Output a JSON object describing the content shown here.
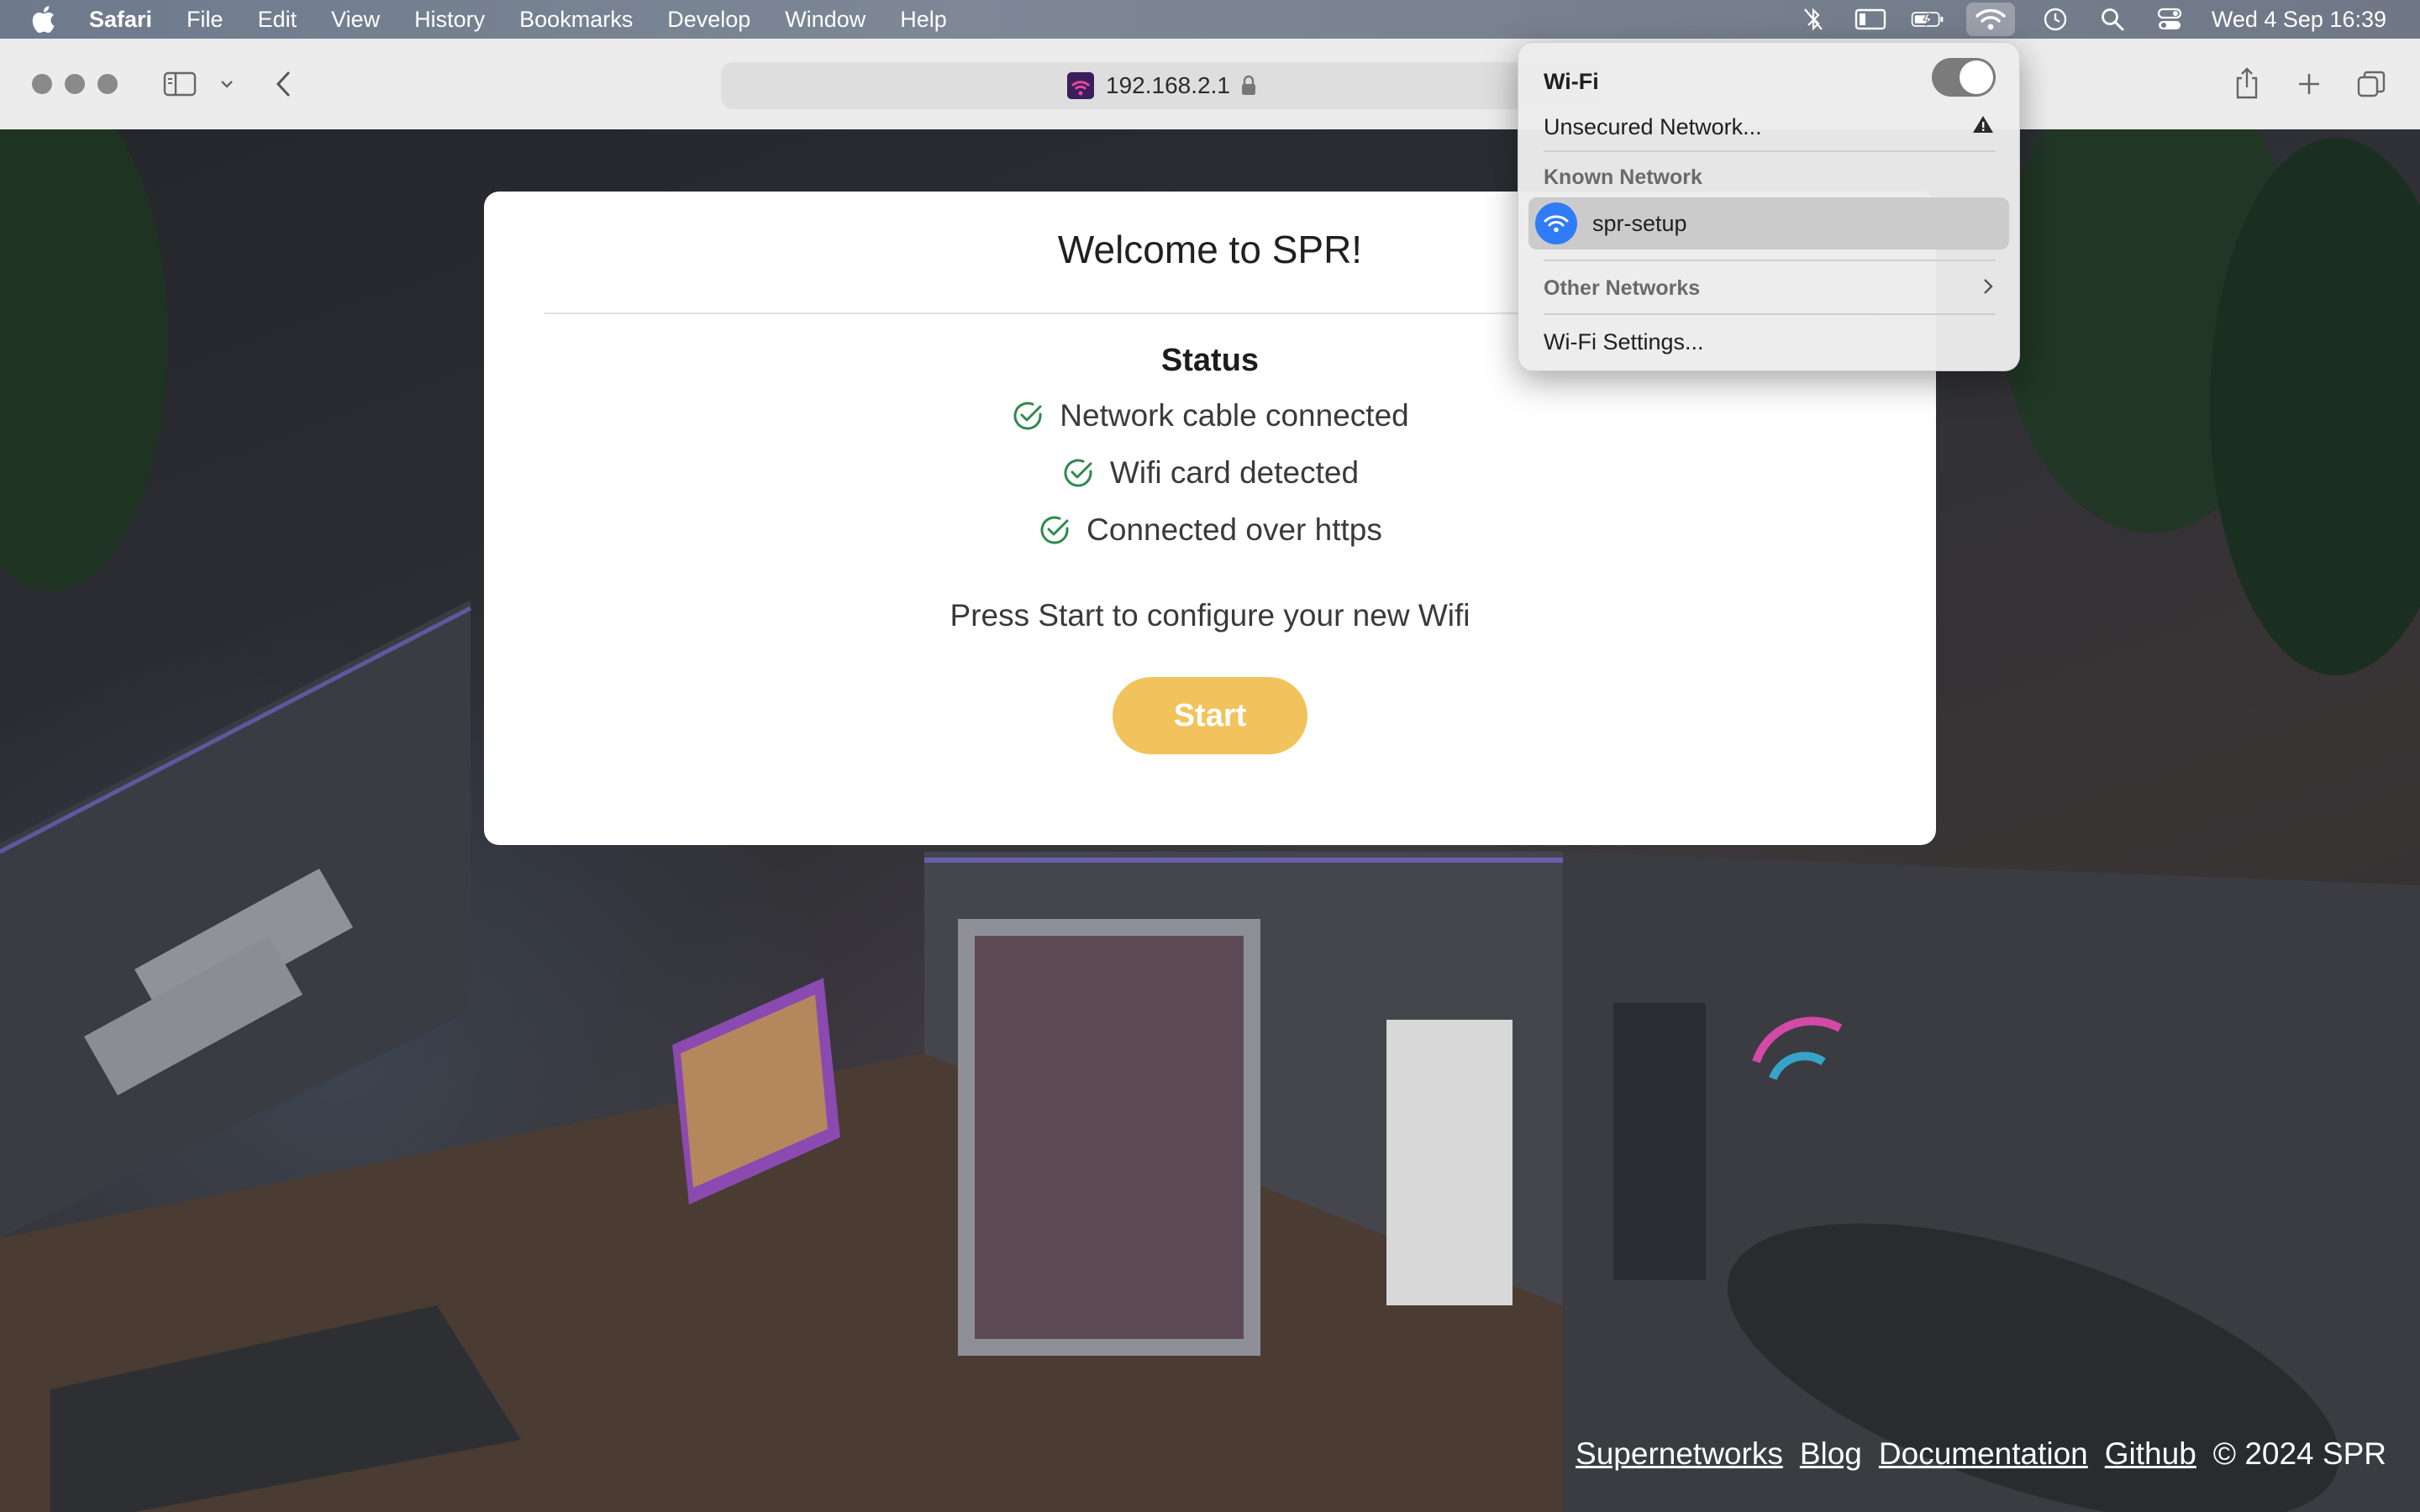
{
  "menubar": {
    "app_name": "Safari",
    "items": [
      "File",
      "Edit",
      "View",
      "History",
      "Bookmarks",
      "Develop",
      "Window",
      "Help"
    ],
    "status_icons": [
      "bluetooth-off-icon",
      "screen-mirroring-icon",
      "battery-charging-icon",
      "wifi-icon",
      "time-machine-icon",
      "spotlight-icon",
      "control-center-icon"
    ],
    "clock": "Wed 4 Sep  16:39"
  },
  "toolbar": {
    "address": "192.168.2.1"
  },
  "card": {
    "title": "Welcome to SPR!",
    "status_title": "Status",
    "status_items": [
      "Network cable connected",
      "Wifi card detected",
      "Connected over https"
    ],
    "hint": "Press Start to configure your new Wifi",
    "start_label": "Start",
    "check_color": "#2f8a4c",
    "button_color": "#f2c35c"
  },
  "footer": {
    "links": [
      "Supernetworks",
      "Blog",
      "Documentation",
      "Github"
    ],
    "copyright": "© 2024 SPR"
  },
  "wifi_menu": {
    "title": "Wi-Fi",
    "enabled": true,
    "unsecured": "Unsecured Network...",
    "known_header": "Known Network",
    "known_network": "spr-setup",
    "other_networks": "Other Networks",
    "settings": "Wi-Fi Settings...",
    "accent_color": "#2f7cf6"
  }
}
